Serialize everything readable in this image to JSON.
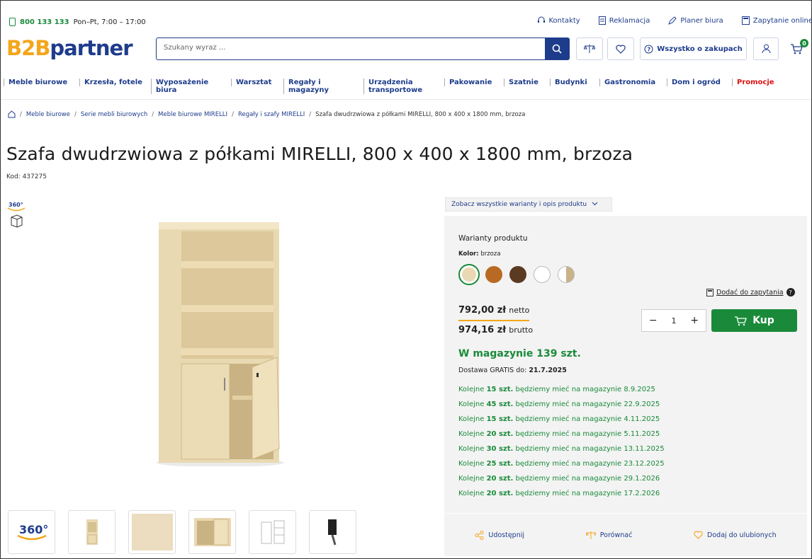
{
  "topbar": {
    "phone": "800 133 133",
    "hours": "Pon–Pt, 7:00 – 17:00",
    "links": [
      "Kontakty",
      "Reklamacja",
      "Planer biura",
      "Zapytanie online"
    ]
  },
  "header": {
    "logo_b": "B2B",
    "logo_p": "partner",
    "search_placeholder": "Szukany wyraz ...",
    "about_label": "Wszystko o zakupach",
    "cart_count": "0"
  },
  "nav": [
    "Meble biurowe",
    "Krzesła, fotele",
    "Wyposażenie biura",
    "Warsztat",
    "Regały i magazyny",
    "Urządzenia transportowe",
    "Pakowanie",
    "Szatnie",
    "Budynki",
    "Gastronomia",
    "Dom i ogród",
    "Promocje"
  ],
  "breadcrumb": [
    "Meble biurowe",
    "Serie mebli biurowych",
    "Meble biurowe MIRELLI",
    "Regały i szafy MIRELLI",
    "Szafa dwudrzwiowa z półkami MIRELLI, 800 x 400 x 1800 mm, brzoza"
  ],
  "product": {
    "title": "Szafa dwudrzwiowa z półkami MIRELLI, 800 x 400 x 1800 mm, brzoza",
    "code": "Kod: 437275",
    "variants_link": "Zobacz wszystkie warianty i opis produktu",
    "variants_heading": "Warianty produktu",
    "color_label": "Kolor:",
    "color_value": "brzoza",
    "add_to_inquiry": "Dodać do zapytania",
    "price_net": "792,00 zł",
    "net_label": "netto",
    "price_gross": "974,16 zł",
    "gross_label": "brutto",
    "qty": "1",
    "buy_label": "Kup",
    "stock": "W magazynie 139 szt.",
    "delivery_label": "Dostawa GRATIS do:",
    "delivery_date": "21.7.2025"
  },
  "restock": [
    {
      "pre": "Kolejne",
      "qty": "15 szt.",
      "post": "będziemy mieć na magazynie 8.9.2025"
    },
    {
      "pre": "Kolejne",
      "qty": "45 szt.",
      "post": "będziemy mieć na magazynie 22.9.2025"
    },
    {
      "pre": "Kolejne",
      "qty": "15 szt.",
      "post": "będziemy mieć na magazynie 4.11.2025"
    },
    {
      "pre": "Kolejne",
      "qty": "20 szt.",
      "post": "będziemy mieć na magazynie 5.11.2025"
    },
    {
      "pre": "Kolejne",
      "qty": "30 szt.",
      "post": "będziemy mieć na magazynie 13.11.2025"
    },
    {
      "pre": "Kolejne",
      "qty": "25 szt.",
      "post": "będziemy mieć na magazynie 23.12.2025"
    },
    {
      "pre": "Kolejne",
      "qty": "20 szt.",
      "post": "będziemy mieć na magazynie 29.1.2026"
    },
    {
      "pre": "Kolejne",
      "qty": "20 szt.",
      "post": "będziemy mieć na magazynie 17.2.2026"
    }
  ],
  "actions": [
    "Udostępnij",
    "Porównać",
    "Dodaj do ulubionych"
  ],
  "gallery": {
    "badge_360": "360°"
  },
  "colors": {
    "brand": "#1e3c8c",
    "accent": "#f4a61c",
    "green": "#1a8a3a"
  }
}
